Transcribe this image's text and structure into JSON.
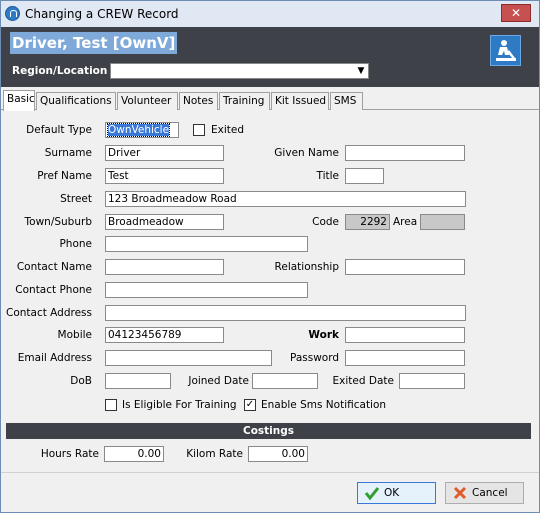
{
  "window": {
    "title": "Changing a CREW Record",
    "close_glyph": "✕"
  },
  "header": {
    "record_name": "Driver,  Test [OwnV]",
    "region_label": "Region/Location",
    "region_value": "",
    "icon": "road-worker-icon"
  },
  "tabs": [
    "Basic",
    "Qualifications",
    "Volunteer",
    "Notes",
    "Training",
    "Kit Issued",
    "SMS"
  ],
  "form": {
    "default_type": {
      "label": "Default Type",
      "value": "OwnVehicle"
    },
    "exited": {
      "label": "Exited",
      "checked": false
    },
    "surname": {
      "label": "Surname",
      "value": "Driver"
    },
    "given_name": {
      "label": "Given Name",
      "value": ""
    },
    "pref_name": {
      "label": "Pref Name",
      "value": "Test"
    },
    "title": {
      "label": "Title",
      "value": ""
    },
    "street": {
      "label": "Street",
      "value": "123 Broadmeadow Road"
    },
    "town": {
      "label": "Town/Suburb",
      "value": "Broadmeadow"
    },
    "code": {
      "label": "Code",
      "value": "2292"
    },
    "area": {
      "label": "Area",
      "value": ""
    },
    "phone": {
      "label": "Phone",
      "value": ""
    },
    "contact_name": {
      "label": "Contact Name",
      "value": ""
    },
    "relationship": {
      "label": "Relationship",
      "value": ""
    },
    "contact_phone": {
      "label": "Contact Phone",
      "value": ""
    },
    "contact_address": {
      "label": "Contact Address",
      "value": ""
    },
    "mobile": {
      "label": "Mobile",
      "value": "04123456789"
    },
    "work": {
      "label": "Work",
      "value": ""
    },
    "email": {
      "label": "Email Address",
      "value": ""
    },
    "password": {
      "label": "Password",
      "value": ""
    },
    "dob": {
      "label": "DoB",
      "value": ""
    },
    "joined_date": {
      "label": "Joined Date",
      "value": ""
    },
    "exited_date": {
      "label": "Exited Date",
      "value": ""
    },
    "eligible_training": {
      "label": "Is Eligible For Training",
      "checked": false
    },
    "sms_notification": {
      "label": "Enable Sms Notification",
      "checked": true,
      "check_glyph": "✓"
    }
  },
  "costings": {
    "heading": "Costings",
    "hours_rate": {
      "label": "Hours Rate",
      "value": "0.00"
    },
    "kilom_rate": {
      "label": "Kilom Rate",
      "value": "0.00"
    }
  },
  "buttons": {
    "ok": "OK",
    "cancel": "Cancel"
  },
  "colors": {
    "header_bg": "#3f4148",
    "accent": "#3a78d8",
    "close_bg": "#c75050"
  }
}
